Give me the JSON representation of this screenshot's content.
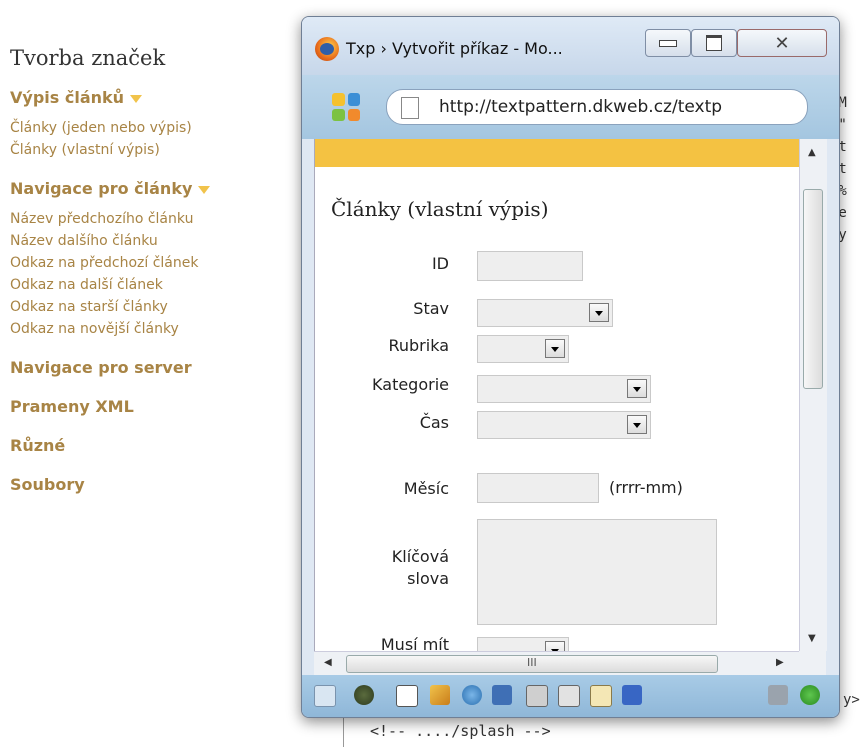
{
  "sidebar": {
    "title": "Tvorba značek",
    "sections": [
      {
        "label": "Výpis článků",
        "links": [
          "Články (jeden nebo výpis)",
          "Články (vlastní výpis)"
        ]
      },
      {
        "label": "Navigace pro články",
        "links": [
          "Název předchozího článku",
          "Název dalšího článku",
          "Odkaz na předchozí článek",
          "Odkaz na další článek",
          "Odkaz na starší články",
          "Odkaz na novější články"
        ]
      },
      {
        "label": "Navigace pro server"
      },
      {
        "label": "Prameny XML"
      },
      {
        "label": "Různé"
      },
      {
        "label": "Soubory"
      }
    ]
  },
  "background": {
    "code_lines": [
      "TM",
      "d\"",
      "nt",
      "",
      "nt",
      ",%",
      "ve",
      "cy"
    ],
    "bottom_comment": "<!-- ..../splash -->",
    "right_fragment": "y>"
  },
  "popup": {
    "title": "Txp › Vytvořit příkaz - Mo...",
    "url": "http://textpattern.dkweb.cz/textp",
    "form": {
      "heading": "Články (vlastní výpis)",
      "labels": {
        "id": "ID",
        "status": "Stav",
        "section": "Rubrika",
        "category": "Kategorie",
        "time": "Čas",
        "month": "Měsíc",
        "keywords_1": "Klíčová",
        "keywords_2": "slova",
        "must_have": "Musí mít"
      },
      "month_hint": "(rrrr-mm)"
    },
    "scrollbar_glyph": "III"
  },
  "colors": {
    "accent": "#a88445",
    "yellow": "#f4c242"
  }
}
